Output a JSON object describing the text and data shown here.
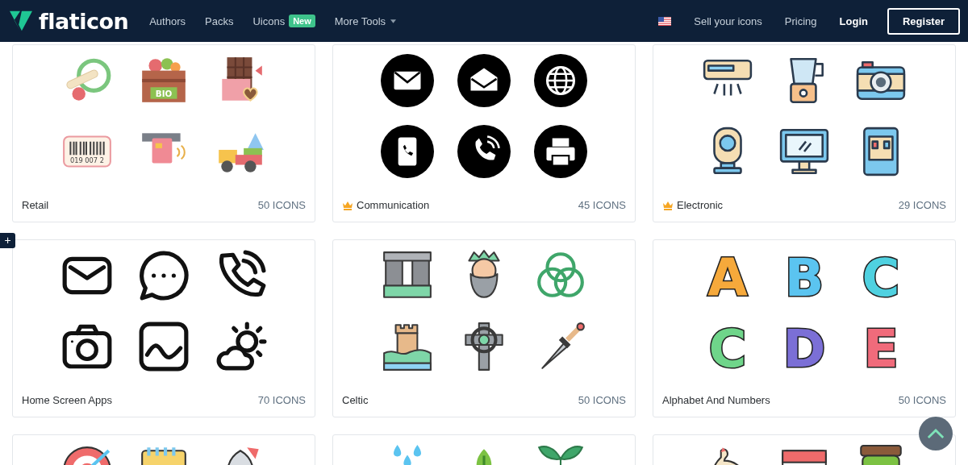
{
  "header": {
    "logo_text": "flaticon",
    "nav": [
      {
        "label": "Authors"
      },
      {
        "label": "Packs"
      },
      {
        "label": "Uicons",
        "badge": "New"
      },
      {
        "label": "More Tools",
        "dropdown": true
      }
    ],
    "sell_link": "Sell your icons",
    "pricing_link": "Pricing",
    "login": "Login",
    "register": "Register"
  },
  "packs": [
    {
      "title": "Retail",
      "count": "50 ICONS",
      "premium": false,
      "crate_label": "BIO",
      "barcode_digits": "019 007 2"
    },
    {
      "title": "Communication",
      "count": "45 ICONS",
      "premium": true
    },
    {
      "title": "Electronic",
      "count": "29 ICONS",
      "premium": true
    },
    {
      "title": "Home Screen Apps",
      "count": "70 ICONS",
      "premium": false
    },
    {
      "title": "Celtic",
      "count": "50 ICONS",
      "premium": false
    },
    {
      "title": "Alphabet And Numbers",
      "count": "50 ICONS",
      "premium": false,
      "letters": [
        "A",
        "B",
        "C",
        "C",
        "D",
        "E"
      ]
    }
  ],
  "side_button": "+"
}
